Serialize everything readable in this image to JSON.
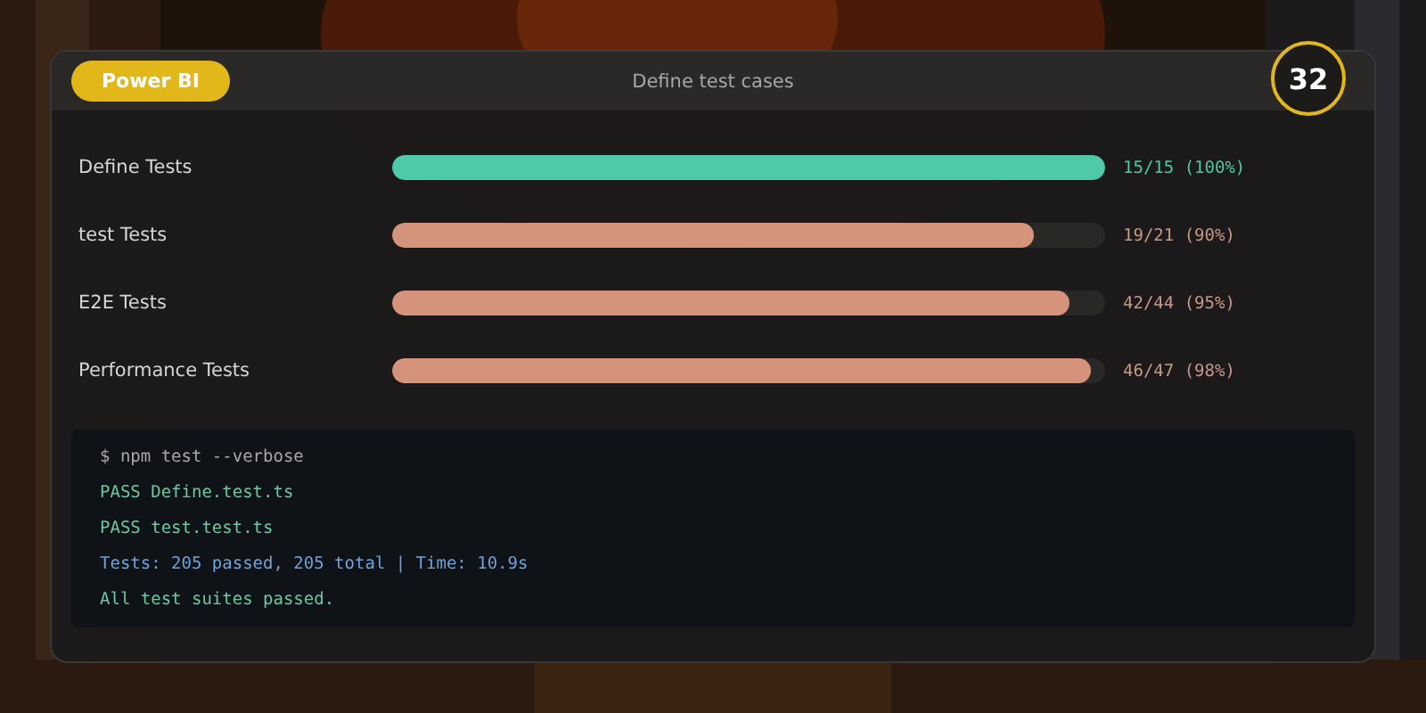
{
  "header": {
    "badge": "Power BI",
    "title": "Define test cases",
    "score": "32"
  },
  "suites": [
    {
      "name": "Define Tests",
      "kind": "complete",
      "level": 1,
      "reading": "15/15 (100%)"
    },
    {
      "name": "test Tests",
      "kind": "partial",
      "level": 0.9,
      "reading": "19/21 (90%)"
    },
    {
      "name": "E2E Tests",
      "kind": "partial",
      "level": 0.95,
      "reading": "42/44 (95%)"
    },
    {
      "name": "Performance Tests",
      "kind": "partial",
      "level": 0.98,
      "reading": "46/47 (98%)"
    }
  ],
  "terminal": [
    {
      "kind": "command",
      "text": "$ npm test --verbose"
    },
    {
      "kind": "pass",
      "text": "PASS Define.test.ts"
    },
    {
      "kind": "pass",
      "text": "PASS test.test.ts"
    },
    {
      "kind": "summary",
      "text": "Tests: 205 passed, 205 total | Time: 10.9s"
    },
    {
      "kind": "success",
      "text": "All test suites passed."
    }
  ]
}
